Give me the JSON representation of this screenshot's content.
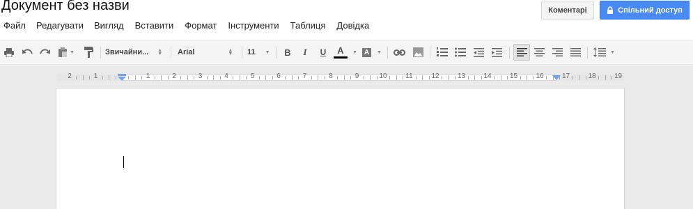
{
  "document": {
    "title": "Документ без назви"
  },
  "header": {
    "comments_label": "Коментарі",
    "share_label": "Спільний доступ",
    "share_icon": "lock-icon"
  },
  "menu": {
    "items": [
      {
        "label": "Файл"
      },
      {
        "label": "Редагувати"
      },
      {
        "label": "Вигляд"
      },
      {
        "label": "Вставити"
      },
      {
        "label": "Формат"
      },
      {
        "label": "Інструменти"
      },
      {
        "label": "Таблиця"
      },
      {
        "label": "Довідка"
      }
    ]
  },
  "toolbar": {
    "paragraph_style": "Звичайни...",
    "font_family": "Arial",
    "font_size": "11",
    "bold_label": "B",
    "italic_label": "I",
    "underline_label": "U",
    "text_color_label": "A",
    "highlight_label": "A",
    "text_color": "#000000",
    "active_alignment": "left",
    "icons": [
      "print-icon",
      "undo-icon",
      "redo-icon",
      "paste-format-icon",
      "paint-format-icon",
      "link-icon",
      "image-icon",
      "numbered-list-icon",
      "bulleted-list-icon",
      "decrease-indent-icon",
      "increase-indent-icon",
      "align-left-icon",
      "align-center-icon",
      "align-right-icon",
      "justify-icon",
      "line-spacing-icon"
    ]
  },
  "ruler": {
    "labels": [
      "2",
      "1",
      "",
      "1",
      "2",
      "3",
      "4",
      "5",
      "6",
      "7",
      "8",
      "9",
      "10",
      "11",
      "12",
      "13",
      "14",
      "15",
      "16",
      "17",
      "18",
      "19"
    ]
  },
  "colors": {
    "share_button": "#4a8af4",
    "toolbar_bg": "#f5f5f5",
    "canvas_bg": "#eaeaea",
    "indent_marker": "#74a1e7"
  }
}
